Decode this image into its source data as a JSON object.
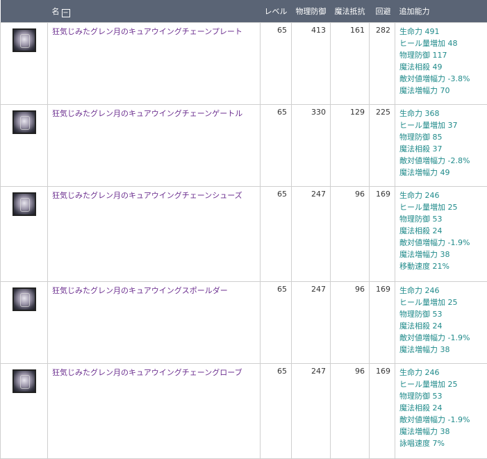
{
  "header": {
    "icon_col": "",
    "name": "名",
    "collapse_symbol": "−",
    "level": "レベル",
    "phys_def": "物理防御",
    "mag_res": "魔法抵抗",
    "evasion": "回避",
    "extra": "追加能力"
  },
  "items": [
    {
      "icon": "armor-plate-icon",
      "name": "狂気じみたグレン月のキュアウイングチェーンプレート",
      "level": "65",
      "phys_def": "413",
      "mag_res": "161",
      "evasion": "282",
      "stats": [
        "生命力 491",
        "ヒール量増加 48",
        "物理防御 117",
        "魔法相殺 49",
        "敵対値増幅力 -3.8%",
        "魔法増幅力 70"
      ]
    },
    {
      "icon": "armor-leggings-icon",
      "name": "狂気じみたグレン月のキュアウイングチェーンゲートル",
      "level": "65",
      "phys_def": "330",
      "mag_res": "129",
      "evasion": "225",
      "stats": [
        "生命力 368",
        "ヒール量増加 37",
        "物理防御 85",
        "魔法相殺 37",
        "敵対値増幅力 -2.8%",
        "魔法増幅力 49"
      ]
    },
    {
      "icon": "armor-shoes-icon",
      "name": "狂気じみたグレン月のキュアウイングチェーンシューズ",
      "level": "65",
      "phys_def": "247",
      "mag_res": "96",
      "evasion": "169",
      "stats": [
        "生命力 246",
        "ヒール量増加 25",
        "物理防御 53",
        "魔法相殺 24",
        "敵対値増幅力 -1.9%",
        "魔法増幅力 38",
        "移動速度 21%"
      ]
    },
    {
      "icon": "armor-shoulder-icon",
      "name": "狂気じみたグレン月のキュアウイングスポールダー",
      "level": "65",
      "phys_def": "247",
      "mag_res": "96",
      "evasion": "169",
      "stats": [
        "生命力 246",
        "ヒール量増加 25",
        "物理防御 53",
        "魔法相殺 24",
        "敵対値増幅力 -1.9%",
        "魔法増幅力 38"
      ]
    },
    {
      "icon": "armor-gloves-icon",
      "name": "狂気じみたグレン月のキュアウイングチェーングローブ",
      "level": "65",
      "phys_def": "247",
      "mag_res": "96",
      "evasion": "169",
      "stats": [
        "生命力 246",
        "ヒール量増加 25",
        "物理防御 53",
        "魔法相殺 24",
        "敵対値増幅力 -1.9%",
        "魔法増幅力 38",
        "詠唱速度 7%"
      ]
    }
  ]
}
